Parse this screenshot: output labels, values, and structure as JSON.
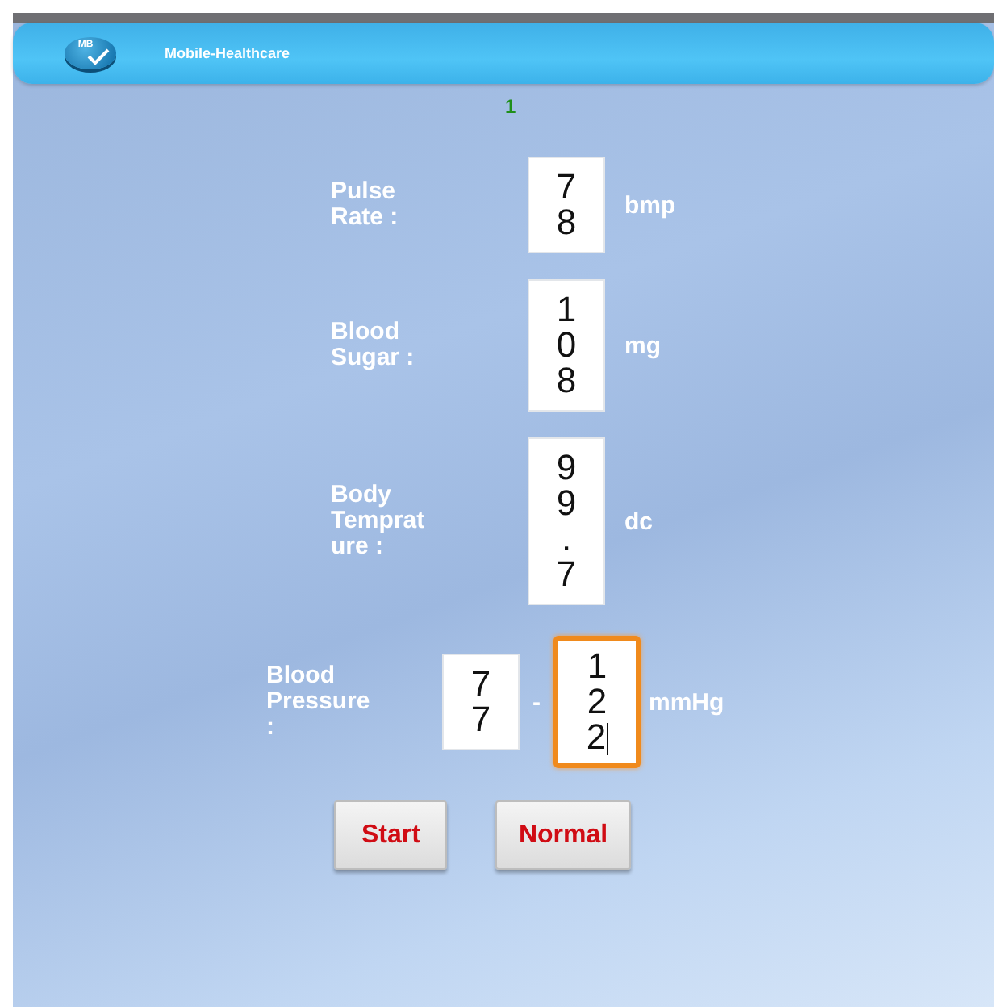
{
  "header": {
    "logo_text": "MB",
    "title": "Mobile-Healthcare"
  },
  "indicator": "1",
  "fields": [
    {
      "kind": "single",
      "label": "Pulse Rate :",
      "inputs": [
        {
          "value": "78",
          "focused": false
        }
      ],
      "unit": "bmp"
    },
    {
      "kind": "single",
      "label": "Blood Sugar :",
      "inputs": [
        {
          "value": "108",
          "focused": false
        }
      ],
      "unit": "mg"
    },
    {
      "kind": "single",
      "label": "Body Temprature :",
      "inputs": [
        {
          "value": "99.7",
          "focused": false
        }
      ],
      "unit": "dc"
    },
    {
      "kind": "pair",
      "label": "Blood Pressure :",
      "inputs": [
        {
          "value": "77",
          "focused": false
        },
        {
          "value": "122",
          "focused": true
        }
      ],
      "separator": "-",
      "unit": "mmHg"
    }
  ],
  "buttons": [
    "Start",
    "Normal"
  ]
}
